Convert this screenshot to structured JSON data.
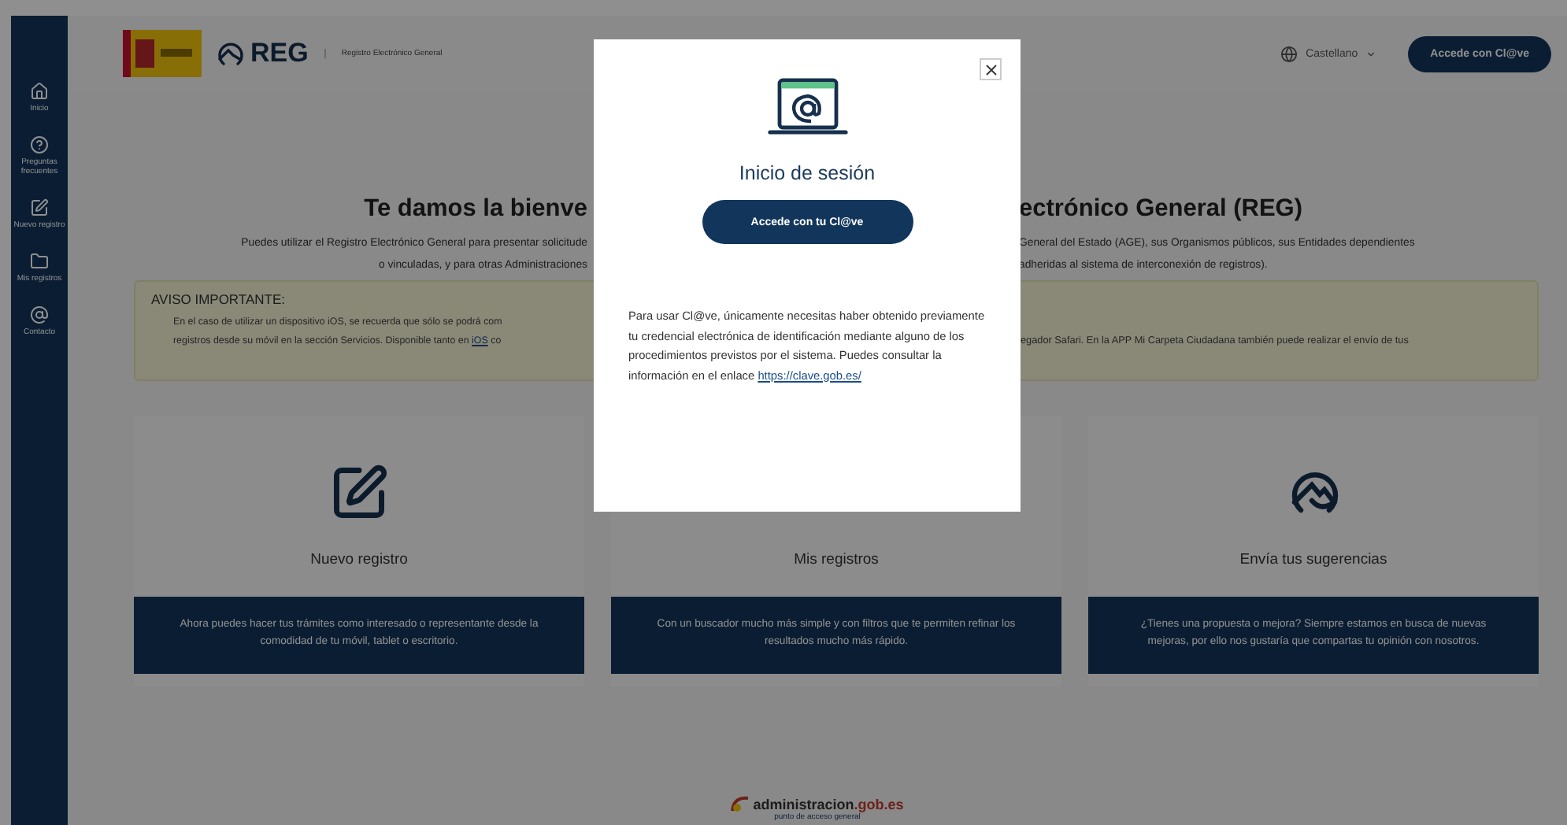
{
  "sidebar": {
    "items": [
      {
        "kind": "home",
        "label": "Inicio"
      },
      {
        "kind": "help",
        "label": "Preguntas frecuentes"
      },
      {
        "kind": "edit",
        "label": "Nuevo registro"
      },
      {
        "kind": "folder",
        "label": "Mis registros"
      },
      {
        "kind": "at",
        "label": "Contacto"
      }
    ]
  },
  "header": {
    "logo_text": "REG",
    "subtitle": "Registro Electrónico General",
    "language": "Castellano",
    "login_button": "Accede con Cl@ve"
  },
  "welcome": {
    "title_left": "Te damos la bienve",
    "title_right": "ectrónico General (REG)",
    "intro_left": [
      "Puedes utilizar el Registro Electrónico General para presentar solicitude",
      "o vinculadas, y para otras Administraciones"
    ],
    "intro_right": [
      "General del Estado (AGE), sus Organismos públicos, sus Entidades dependientes",
      "adheridas al sistema de interconexión de registros)."
    ]
  },
  "notice": {
    "title": "AVISO IMPORTANTE:",
    "left_first": "En el caso de utilizar un dispositivo iOS, se recuerda que sólo se podrá com",
    "left_second": {
      "before": "registros desde su móvil en la sección Servicios. Disponible tanto en",
      "link": "iOS",
      "after": "co"
    },
    "right_first": "egador Safari. En la APP Mi Carpeta Ciudadana también puede realizar el envío de tus"
  },
  "cards": [
    {
      "kind": "edit",
      "title": "Nuevo registro",
      "description": "Ahora puedes hacer tus trámites como interesado o representante desde la comodidad de tu móvil, tablet o escritorio."
    },
    {
      "kind": "covered",
      "title": "Mis registros",
      "description": "Con un buscador mucho más simple y con filtros que te permiten refinar los resultados mucho más rápido."
    },
    {
      "kind": "logo",
      "title": "Envía tus sugerencias",
      "description": "¿Tienes una propuesta o mejora? Siempre estamos en busca de nuevas mejoras, por ello nos gustaría que compartas tu opinión con nosotros."
    }
  ],
  "footer": {
    "brand": "administracion",
    "brand_suffix": ".gob.es",
    "tagline": "punto de acceso general"
  },
  "modal": {
    "title": "Inicio de sesión",
    "button": "Accede con tu Cl@ve",
    "text": "Para usar Cl@ve, únicamente necesitas haber obtenido previamente tu credencial electrónica de identificación mediante alguno de los procedimientos previstos por el sistema. Puedes consultar la información en el enlace",
    "link": "https://clave.gob.es/"
  }
}
